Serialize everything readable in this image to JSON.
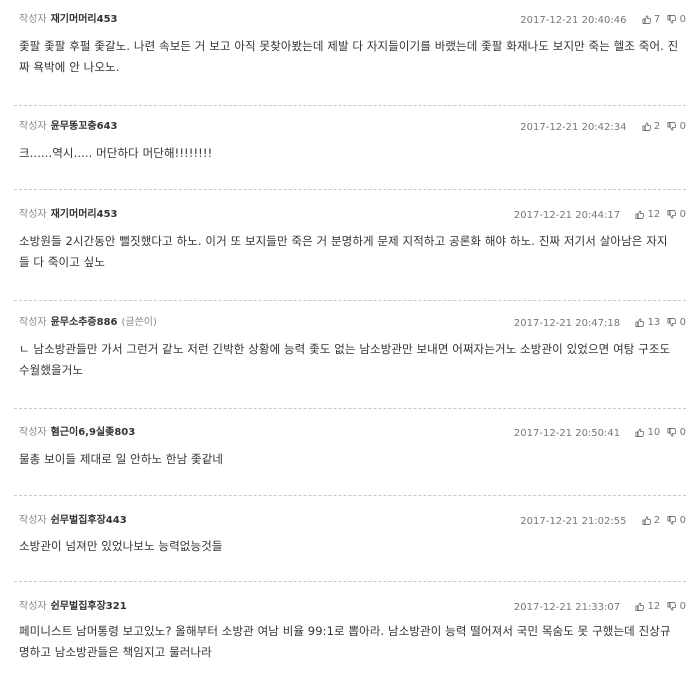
{
  "author_label": "작성자",
  "comments": [
    {
      "author": "재기머머리453",
      "note": "",
      "date": "2017-12-21 20:40:46",
      "up": "7",
      "down": "0",
      "lines": [
        "좇팔 좇팔 후펄 좇갈노. 나련 속보든 거 보고 아직 못찾아봤는데 제발 다 자지들이기를 바랬는데 좇팔 화재나도 보지만 죽는 헬조 죽어. 진",
        "짜 욕박에 안 나오노."
      ]
    },
    {
      "author": "윤무똥꼬충643",
      "note": "",
      "date": "2017-12-21 20:42:34",
      "up": "2",
      "down": "0",
      "lines": [
        "크......역시..... 머단하다 머단해!!!!!!!!"
      ]
    },
    {
      "author": "재기머머리453",
      "note": "",
      "date": "2017-12-21 20:44:17",
      "up": "12",
      "down": "0",
      "lines": [
        "소방원들 2시간동안 뻘짓했다고 하노. 이거 또 보지들만 죽은 거 분명하게 문제 지적하고 공론화 해야 하노. 진짜 저기서 살아남은 자지",
        "들 다 죽이고 싶노"
      ]
    },
    {
      "author": "윤무소추증886",
      "note": "(글쓴이)",
      "date": "2017-12-21 20:47:18",
      "up": "13",
      "down": "0",
      "lines": [
        "ㄴ 남소방관들만 가서 그런거 같노 저런 긴박한 상황에 능력 좇도 없는 남소방관만 보내면 어쩌자는거노 소방관이 있었으면 여탕 구조도",
        "수월했을거노"
      ]
    },
    {
      "author": "혐근이6,9실좆803",
      "note": "",
      "date": "2017-12-21 20:50:41",
      "up": "10",
      "down": "0",
      "lines": [
        "물총 보이들 제대로 일 안하노 한남 좇같네"
      ]
    },
    {
      "author": "쉰무벌집후장443",
      "note": "",
      "date": "2017-12-21 21:02:55",
      "up": "2",
      "down": "0",
      "lines": [
        "소방관이 넘져만 있었나보노 능력없능것들"
      ]
    },
    {
      "author": "쉰무벌집후장321",
      "note": "",
      "date": "2017-12-21 21:33:07",
      "up": "12",
      "down": "0",
      "lines": [
        "페미니스트 남머통령 보고있노? 올해부터 소방관 여남 비율 99:1로 뽑아라. 남소방관이 능력 떨어져서 국민 목숨도 못 구했는데 진상규",
        "명하고 남소방관들은 책임지고 물러나라"
      ]
    }
  ],
  "icons": {
    "up": "thumbs-up-icon",
    "down": "thumbs-down-icon"
  }
}
